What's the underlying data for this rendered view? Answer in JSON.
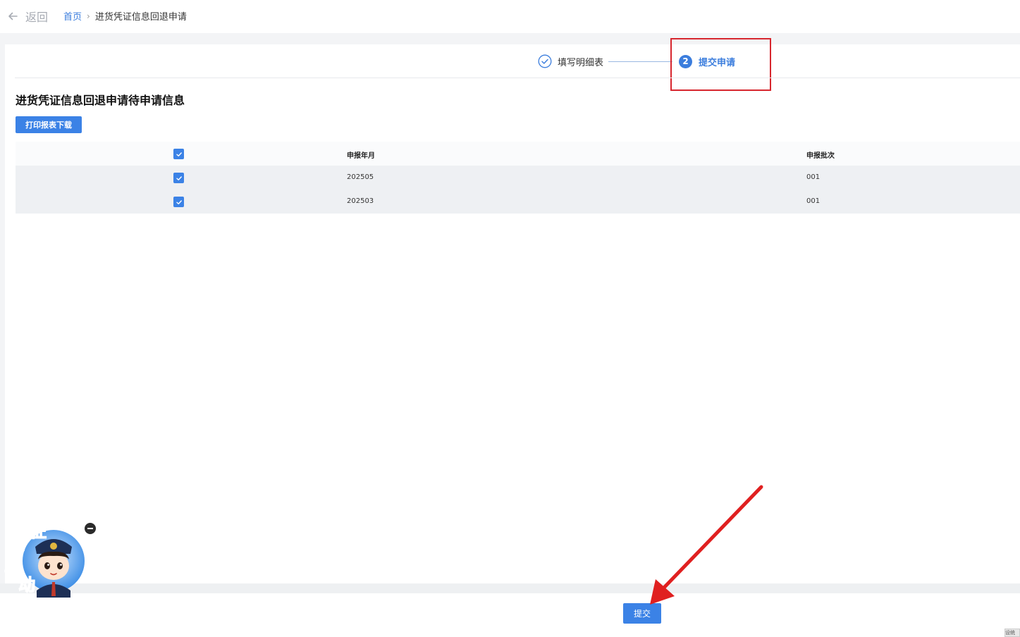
{
  "header": {
    "back_label": "返回",
    "breadcrumb": {
      "home": "首页",
      "separator": "›",
      "current": "进货凭证信息回退申请"
    }
  },
  "steps": [
    {
      "index": "1",
      "label": "填写明细表",
      "status": "done"
    },
    {
      "index": "2",
      "label": "提交申请",
      "status": "active"
    }
  ],
  "section": {
    "title": "进货凭证信息回退申请待申请信息",
    "print_button": "打印报表下载"
  },
  "table": {
    "columns": [
      "申报年月",
      "申报批次"
    ],
    "header_checked": true,
    "rows": [
      {
        "checked": true,
        "month": "202505",
        "batch": "001"
      },
      {
        "checked": true,
        "month": "202503",
        "batch": "001"
      }
    ]
  },
  "footer": {
    "submit_button": "提交",
    "corner_text": "设统"
  },
  "mascot": {
    "text": [
      "征",
      "纳",
      "互",
      "动"
    ]
  },
  "colors": {
    "primary": "#3b82e6",
    "link": "#3b7ddd",
    "annotation": "#e02020"
  }
}
